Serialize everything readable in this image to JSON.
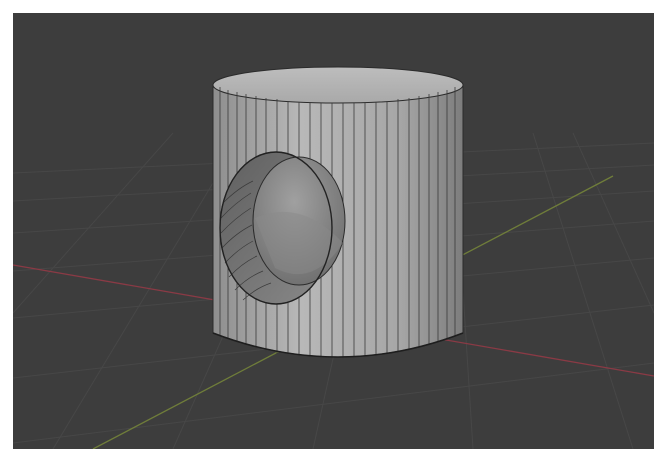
{
  "viewport": {
    "background_color": "#3d3d3d",
    "grid_color": "#4a4a4a",
    "x_axis_color": "#8a3a45",
    "y_axis_color": "#6f7d3a"
  },
  "object": {
    "name_icon": "cylinder-mesh-icon",
    "face_color": "#a8a8a8",
    "edge_color": "#2b2b2b",
    "hole_interior_color": "#7a7a7a",
    "hole_far_color": "#9a9a9a"
  }
}
